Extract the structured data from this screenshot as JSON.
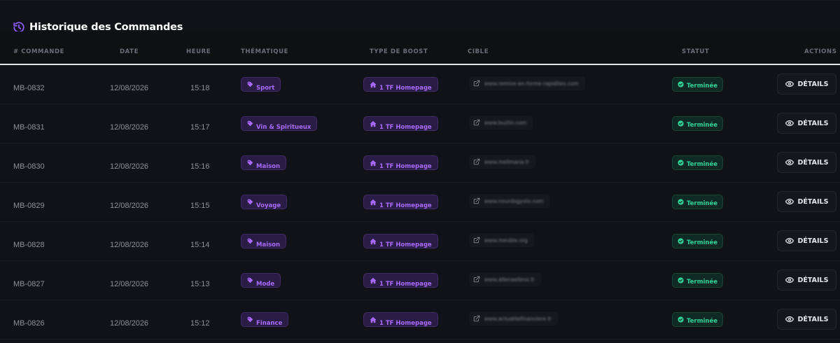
{
  "header": {
    "title": "Historique des Commandes",
    "icon": "history-icon",
    "accent_color": "#8b5cf6"
  },
  "columns": {
    "order": "# COMMANDE",
    "date": "DATE",
    "time": "HEURE",
    "theme": "THÉMATIQUE",
    "boost": "TYPE DE BOOST",
    "target": "CIBLE",
    "status": "STATUT",
    "actions": "ACTIONS"
  },
  "colors": {
    "theme_pill": "#a86bff",
    "status_done": "#34d399"
  },
  "orders": [
    {
      "id": "MB-0832",
      "date": "12/08/2026",
      "time": "15:18",
      "theme": "Sport",
      "boost": "1 TF Homepage",
      "target": "www.remise-en-forme-rapidites.com",
      "status": "Terminée",
      "action": "DÉTAILS"
    },
    {
      "id": "MB-0831",
      "date": "12/08/2026",
      "time": "15:17",
      "theme": "Vin & Spiritueux",
      "boost": "1 TF Homepage",
      "target": "www.buzlin.com",
      "status": "Terminée",
      "action": "DÉTAILS"
    },
    {
      "id": "MB-0830",
      "date": "12/08/2026",
      "time": "15:16",
      "theme": "Maison",
      "boost": "1 TF Homepage",
      "target": "www.meilmaria.fr",
      "status": "Terminée",
      "action": "DÉTAILS"
    },
    {
      "id": "MB-0829",
      "date": "12/08/2026",
      "time": "15:15",
      "theme": "Voyage",
      "boost": "1 TF Homepage",
      "target": "www.nourdogyolo.com",
      "status": "Terminée",
      "action": "DÉTAILS"
    },
    {
      "id": "MB-0828",
      "date": "12/08/2026",
      "time": "15:14",
      "theme": "Maison",
      "boost": "1 TF Homepage",
      "target": "www.meuble.org",
      "status": "Terminée",
      "action": "DÉTAILS"
    },
    {
      "id": "MB-0827",
      "date": "12/08/2026",
      "time": "15:13",
      "theme": "Mode",
      "boost": "1 TF Homepage",
      "target": "www.allenaelless.fr",
      "status": "Terminée",
      "action": "DÉTAILS"
    },
    {
      "id": "MB-0826",
      "date": "12/08/2026",
      "time": "15:12",
      "theme": "Finance",
      "boost": "1 TF Homepage",
      "target": "www.actualitefinanciere.fr",
      "status": "Terminée",
      "action": "DÉTAILS"
    }
  ]
}
